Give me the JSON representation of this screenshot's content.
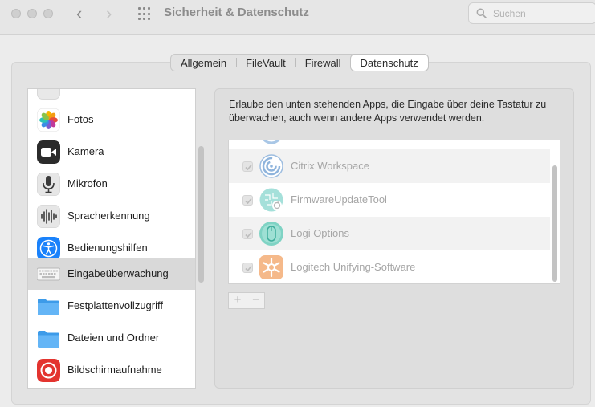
{
  "window": {
    "title": "Sicherheit & Datenschutz",
    "search_placeholder": "Suchen"
  },
  "tabs": [
    {
      "label": "Allgemein",
      "active": false
    },
    {
      "label": "FileVault",
      "active": false
    },
    {
      "label": "Firewall",
      "active": false
    },
    {
      "label": "Datenschutz",
      "active": true
    }
  ],
  "sidebar": {
    "items": [
      {
        "label": "",
        "icon": "partial-icon",
        "selected": false
      },
      {
        "label": "Fotos",
        "icon": "photos-icon",
        "selected": false
      },
      {
        "label": "Kamera",
        "icon": "camera-icon",
        "selected": false
      },
      {
        "label": "Mikrofon",
        "icon": "microphone-icon",
        "selected": false
      },
      {
        "label": "Spracherkennung",
        "icon": "waveform-icon",
        "selected": false
      },
      {
        "label": "Bedienungshilfen",
        "icon": "accessibility-icon",
        "selected": false
      },
      {
        "label": "Eingabeüberwachung",
        "icon": "keyboard-icon",
        "selected": true
      },
      {
        "label": "Festplattenvollzugriff",
        "icon": "folder-icon",
        "selected": false
      },
      {
        "label": "Dateien und Ordner",
        "icon": "folder-icon",
        "selected": false
      },
      {
        "label": "Bildschirmaufnahme",
        "icon": "screen-record-icon",
        "selected": false
      }
    ]
  },
  "main": {
    "description": "Erlaube den unten stehenden Apps, die Eingabe über deine Tastatur zu überwachen, auch wenn andere Apps verwendet werden.",
    "apps": [
      {
        "name": "",
        "checked": true,
        "icon": "partial-app-icon"
      },
      {
        "name": "Citrix Workspace",
        "checked": true,
        "icon": "citrix-icon"
      },
      {
        "name": "FirmwareUpdateTool",
        "checked": true,
        "icon": "firmware-tool-icon"
      },
      {
        "name": "Logi Options",
        "checked": true,
        "icon": "logi-mouse-icon"
      },
      {
        "name": "Logitech Unifying-Software",
        "checked": true,
        "icon": "logitech-unifying-icon"
      }
    ],
    "add_label": "+",
    "remove_label": "−"
  },
  "colors": {
    "accent_blue": "#1a82fb",
    "selection_gray": "#d9d9d9",
    "screen_record_red": "#e3342f",
    "folder_blue": "#4fa8ec"
  }
}
